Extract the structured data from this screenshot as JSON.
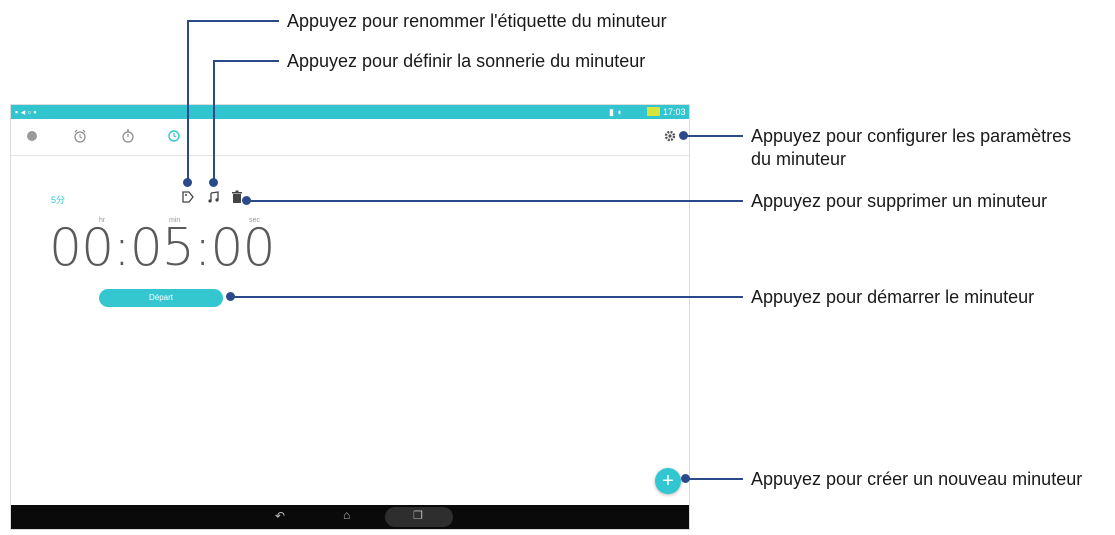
{
  "status_bar": {
    "color": "#33c5cf",
    "time": "17:03"
  },
  "tabs": [
    {
      "name": "world-clock",
      "icon": "globe-icon"
    },
    {
      "name": "alarm",
      "icon": "alarm-icon"
    },
    {
      "name": "stopwatch",
      "icon": "stopwatch-icon"
    },
    {
      "name": "timer",
      "icon": "timer-icon",
      "active": true
    }
  ],
  "timer": {
    "label": "5分",
    "unit_hr": "hr",
    "unit_min": "min",
    "unit_sec": "sec",
    "value": "00:05:00",
    "start_label": "Départ"
  },
  "callouts": {
    "rename_label": "Appuyez pour renommer l'étiquette du minuteur",
    "set_ringtone": "Appuyez pour définir la sonnerie du minuteur",
    "settings_line1": "Appuyez pour configurer les paramètres",
    "settings_line2": "du minuteur",
    "delete": "Appuyez pour supprimer un minuteur",
    "start": "Appuyez pour démarrer le minuteur",
    "create": "Appuyez pour créer un nouveau minuteur"
  },
  "colors": {
    "accent": "#33c5cf",
    "callout_line": "#2a4a8a"
  }
}
